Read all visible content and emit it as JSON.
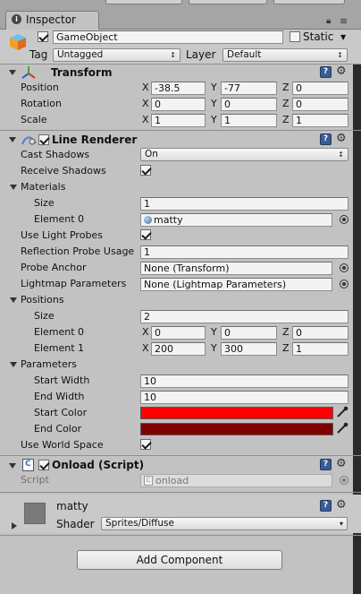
{
  "tab": {
    "title": "Inspector"
  },
  "gameobject": {
    "name": "GameObject",
    "static_label": "Static",
    "tag_label": "Tag",
    "tag_value": "Untagged",
    "layer_label": "Layer",
    "layer_value": "Default"
  },
  "transform": {
    "title": "Transform",
    "rows": [
      {
        "label": "Position",
        "x": "-38.5",
        "y": "-77",
        "z": "0"
      },
      {
        "label": "Rotation",
        "x": "0",
        "y": "0",
        "z": "0"
      },
      {
        "label": "Scale",
        "x": "1",
        "y": "1",
        "z": "1"
      }
    ]
  },
  "axis": {
    "x": "X",
    "y": "Y",
    "z": "Z"
  },
  "line_renderer": {
    "title": "Line Renderer",
    "cast_shadows_label": "Cast Shadows",
    "cast_shadows_value": "On",
    "receive_shadows_label": "Receive Shadows",
    "materials_label": "Materials",
    "size_label": "Size",
    "materials_size": "1",
    "element0_label": "Element 0",
    "element0_value": "matty",
    "use_light_probes_label": "Use Light Probes",
    "reflection_probe_usage_label": "Reflection Probe Usage",
    "reflection_probe_usage_value": "1",
    "probe_anchor_label": "Probe Anchor",
    "probe_anchor_value": "None (Transform)",
    "lightmap_parameters_label": "Lightmap Parameters",
    "lightmap_parameters_value": "None (Lightmap Parameters)",
    "positions_label": "Positions",
    "positions_size": "2",
    "positions": [
      {
        "label": "Element 0",
        "x": "0",
        "y": "0",
        "z": "0"
      },
      {
        "label": "Element 1",
        "x": "200",
        "y": "300",
        "z": "1"
      }
    ],
    "parameters_label": "Parameters",
    "start_width_label": "Start Width",
    "start_width_value": "10",
    "end_width_label": "End Width",
    "end_width_value": "10",
    "start_color_label": "Start Color",
    "start_color": "#ff0000",
    "end_color_label": "End Color",
    "end_color": "#800000",
    "use_world_space_label": "Use World Space"
  },
  "onload_script": {
    "title": "Onload (Script)",
    "script_label": "Script",
    "script_value": "onload"
  },
  "material": {
    "name": "matty",
    "shader_label": "Shader",
    "shader_value": "Sprites/Diffuse"
  },
  "add_component_label": "Add Component"
}
